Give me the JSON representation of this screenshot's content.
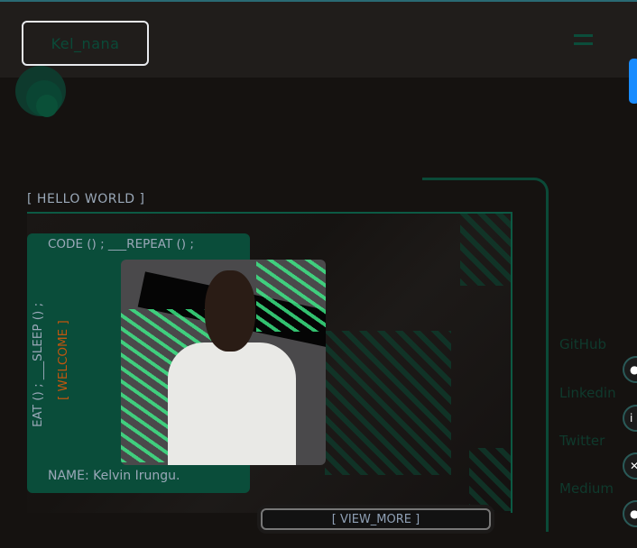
{
  "header": {
    "logo": "Kel_nana",
    "menu_icon": "hamburger-icon"
  },
  "hero": {
    "heading": "[ HELLO WORLD ]",
    "card": {
      "code_line": "CODE () ; ___REPEAT () ;",
      "vertical_line": "EAT () ; ___SLEEP () ;",
      "welcome": "[ WELCOME ]",
      "name": "NAME: Kelvin Irungu."
    },
    "view_more": "[ VIEW_MORE ]"
  },
  "social": [
    {
      "label": "GitHub",
      "icon": "github-icon"
    },
    {
      "label": "Linkedin",
      "icon": "linkedin-icon"
    },
    {
      "label": "Twitter",
      "icon": "x-icon"
    },
    {
      "label": "Medium",
      "icon": "medium-icon"
    }
  ],
  "colors": {
    "accent": "#0a4d3a",
    "welcome": "#c0560f",
    "scrollbar": "#1a8cff"
  }
}
